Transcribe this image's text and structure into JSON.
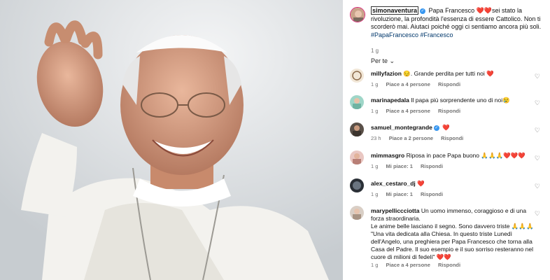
{
  "caption": {
    "username": "simonaventura",
    "hearts": "❤️❤️",
    "text_part1": "Papa Francesco ",
    "text_part2": "sei stato la rivoluzione, la profondità l'essenza di essere Cattolico. Non ti scorderò mai. Aiutaci poiché oggi ci sentiamo ancora più soli.",
    "hashtags": "#PapaFrancesco #Francesco",
    "time": "1 g"
  },
  "sort_label": "Per te ⌄",
  "comments": [
    {
      "user": "millyfazion",
      "text": "😔. Grande perdita per tutti noi ❤️",
      "time": "1 g",
      "likes": "Piace a 4 persone",
      "reply": "Rispondi"
    },
    {
      "user": "marinapedala",
      "text": "Il papa più sorprendente uno di noi😢",
      "time": "1 g",
      "likes": "Piace a 4 persone",
      "reply": "Rispondi"
    },
    {
      "user": "samuel_montegrande",
      "text": "❤️",
      "time": "23 h",
      "likes": "Piace a 2 persone",
      "reply": "Rispondi"
    },
    {
      "user": "mimmasgro",
      "text": "Riposa in pace Papa buono 🙏🙏🙏❤️❤️❤️",
      "time": "1 g",
      "likes": "Mi piace: 1",
      "reply": "Rispondi"
    },
    {
      "user": "alex_cestaro_dj",
      "text": "❤️",
      "time": "1 g",
      "likes": "Mi piace: 1",
      "reply": "Rispondi"
    },
    {
      "user": "marypelliccciotta",
      "text": "Un uomo immenso, coraggioso e di una forza straordinaria.",
      "text2": "Le anime belle lasciano il segno. Sono davvero triste 🙏🙏🙏",
      "text3": "\"Una vita dedicata alla Chiesa. In questo triste Lunedì dell'Angelo, una preghiera per Papa Francesco che torna alla Casa del Padre. Il suo esempio e il suo sorriso resteranno nel cuore di milioni di fedeli\" ❤️❤️",
      "time": "1 g",
      "likes": "Piace a 4 persone",
      "reply": "Rispondi"
    }
  ]
}
